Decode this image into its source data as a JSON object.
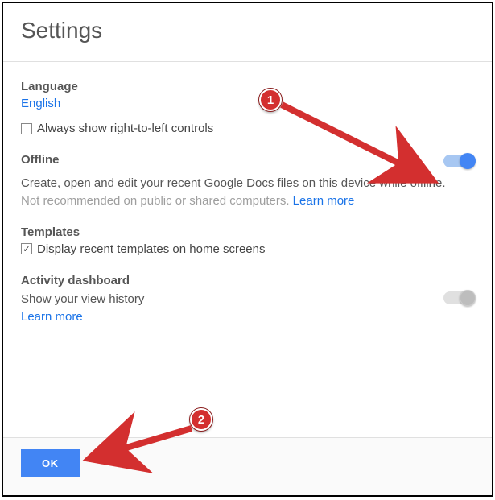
{
  "header": {
    "title": "Settings"
  },
  "language": {
    "title": "Language",
    "value": "English",
    "rtl_checkbox_label": "Always show right-to-left controls",
    "rtl_checked": false
  },
  "offline": {
    "title": "Offline",
    "description": "Create, open and edit your recent Google Docs files on this device while offline.",
    "warning": "Not recommended on public or shared computers. ",
    "learn_more": "Learn more",
    "toggle_on": true
  },
  "templates": {
    "title": "Templates",
    "checkbox_label": "Display recent templates on home screens",
    "checked": true
  },
  "activity": {
    "title": "Activity dashboard",
    "description": "Show your view history",
    "learn_more": "Learn more",
    "toggle_on": false
  },
  "footer": {
    "ok_label": "OK"
  },
  "annotations": {
    "badge1": "1",
    "badge2": "2"
  }
}
